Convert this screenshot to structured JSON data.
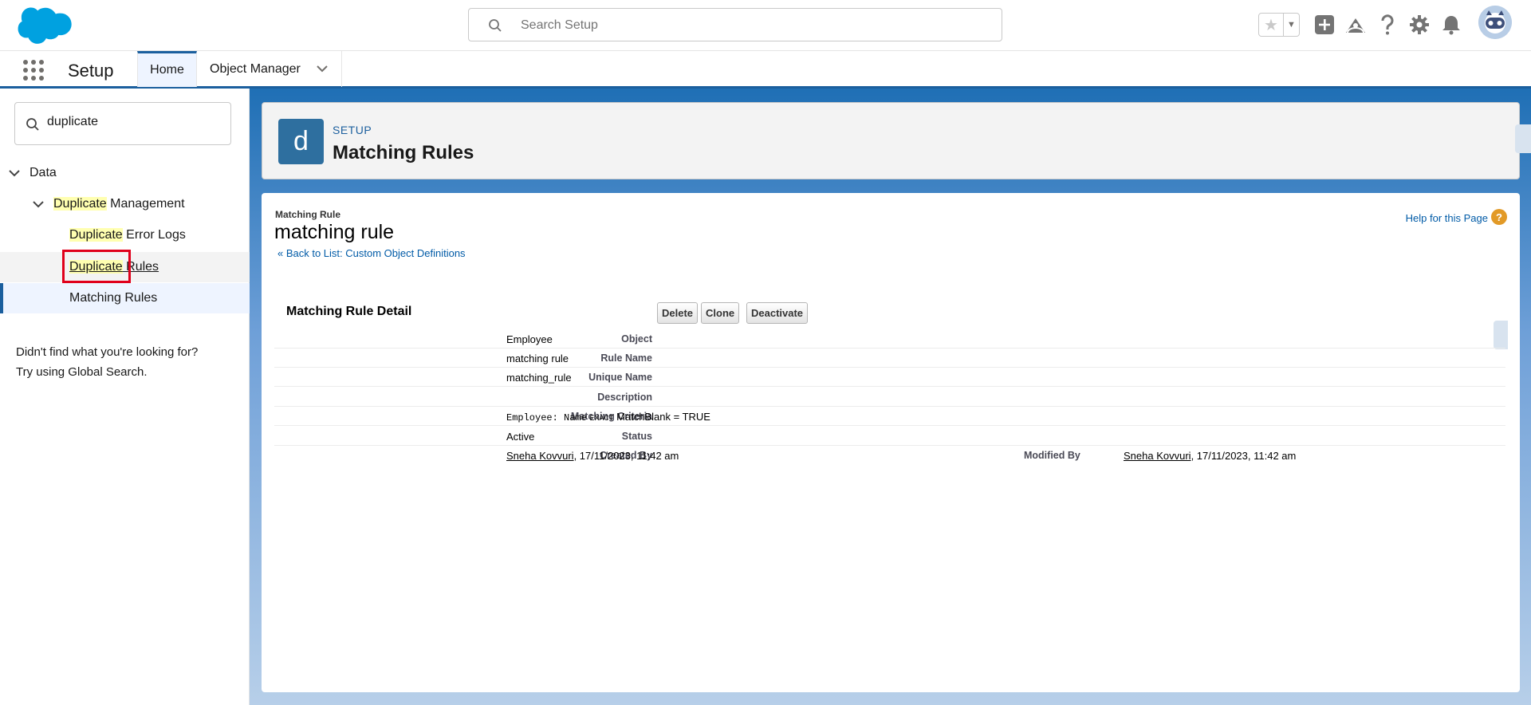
{
  "global_header": {
    "search_placeholder": "Search Setup",
    "icons": [
      "favorites-star-icon",
      "favorites-dropdown-icon",
      "global-actions-icon",
      "trailhead-icon",
      "help-icon",
      "setup-gear-icon",
      "notifications-bell-icon",
      "user-avatar"
    ]
  },
  "context_bar": {
    "app_name": "Setup",
    "tabs": [
      {
        "label": "Home"
      },
      {
        "label": "Object Manager"
      }
    ]
  },
  "sidebar": {
    "quick_find_value": "duplicate",
    "tree": {
      "data_label": "Data",
      "dup_mgmt_hl": "Duplicate",
      "dup_mgmt_rest": " Management",
      "error_logs_hl": "Duplicate",
      "error_logs_rest": " Error Logs",
      "dup_rules_hl": "Duplicate",
      "dup_rules_rest": " Rules",
      "matching_rules": "Matching Rules"
    },
    "not_found_line1": "Didn't find what you're looking for?",
    "not_found_line2": "Try using Global Search."
  },
  "page_header": {
    "icon_letter": "d",
    "label": "SETUP",
    "title": "Matching Rules"
  },
  "record": {
    "type": "Matching Rule",
    "name": "matching rule",
    "back_link": "« Back to List: Custom Object Definitions",
    "help_link": "Help for this Page",
    "help_icon": "?"
  },
  "detail": {
    "title": "Matching Rule Detail",
    "buttons": {
      "delete": "Delete",
      "clone": "Clone",
      "deactivate": "Deactivate"
    },
    "fields": {
      "object_label": "Object",
      "object_value": "Employee",
      "rule_name_label": "Rule Name",
      "rule_name_value": "matching rule",
      "unique_name_label": "Unique Name",
      "unique_name_value": "matching_rule",
      "description_label": "Description",
      "description_value": "",
      "criteria_label": "Matching Criteria",
      "criteria_code": "Employee: Name",
      "criteria_exact": "EXACT",
      "criteria_rest": " MatchBlank = TRUE",
      "status_label": "Status",
      "status_value": "Active",
      "created_by_label": "Created By",
      "created_by_user": "Sneha Kovvuri",
      "created_by_date": ", 17/11/2023, 11:42 am",
      "modified_by_label": "Modified By",
      "modified_by_user": "Sneha Kovvuri",
      "modified_by_date": ", 17/11/2023, 11:42 am"
    }
  },
  "colors": {
    "brand_blue": "#1b5f9e",
    "header_icon_bg": "#2e6f9f",
    "highlight": "#ffffb0",
    "annotation_red": "#e0001b",
    "link": "#015ba7"
  }
}
